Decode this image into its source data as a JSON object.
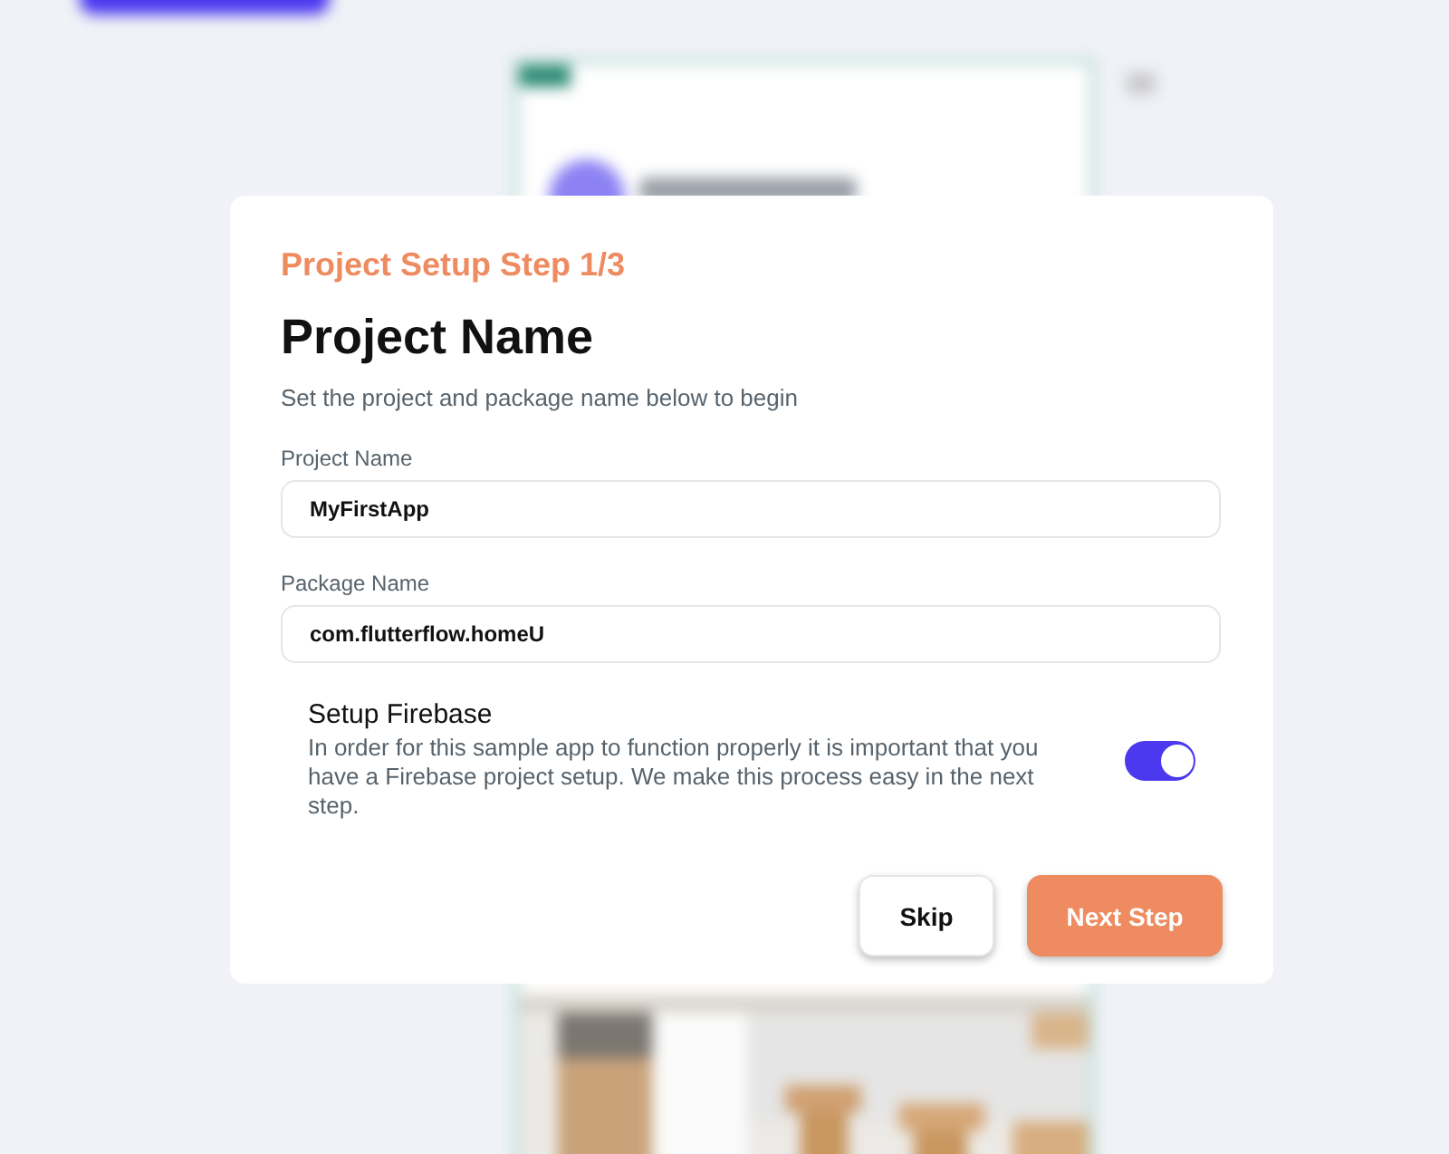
{
  "dialog": {
    "step_label": "Project Setup Step 1/3",
    "title": "Project Name",
    "subtitle": "Set the project and package name below to begin",
    "fields": [
      {
        "label": "Project Name",
        "value": "MyFirstApp"
      },
      {
        "label": "Package Name",
        "value": "com.flutterflow.homeU"
      }
    ],
    "firebase": {
      "title": "Setup Firebase",
      "description": "In order for this sample app to function properly it is important that you have a Firebase project setup. We make this process easy in the next step.",
      "on": true
    },
    "buttons": [
      {
        "label": "Skip",
        "kind": "secondary"
      },
      {
        "label": "Next Step",
        "kind": "primary"
      }
    ]
  }
}
